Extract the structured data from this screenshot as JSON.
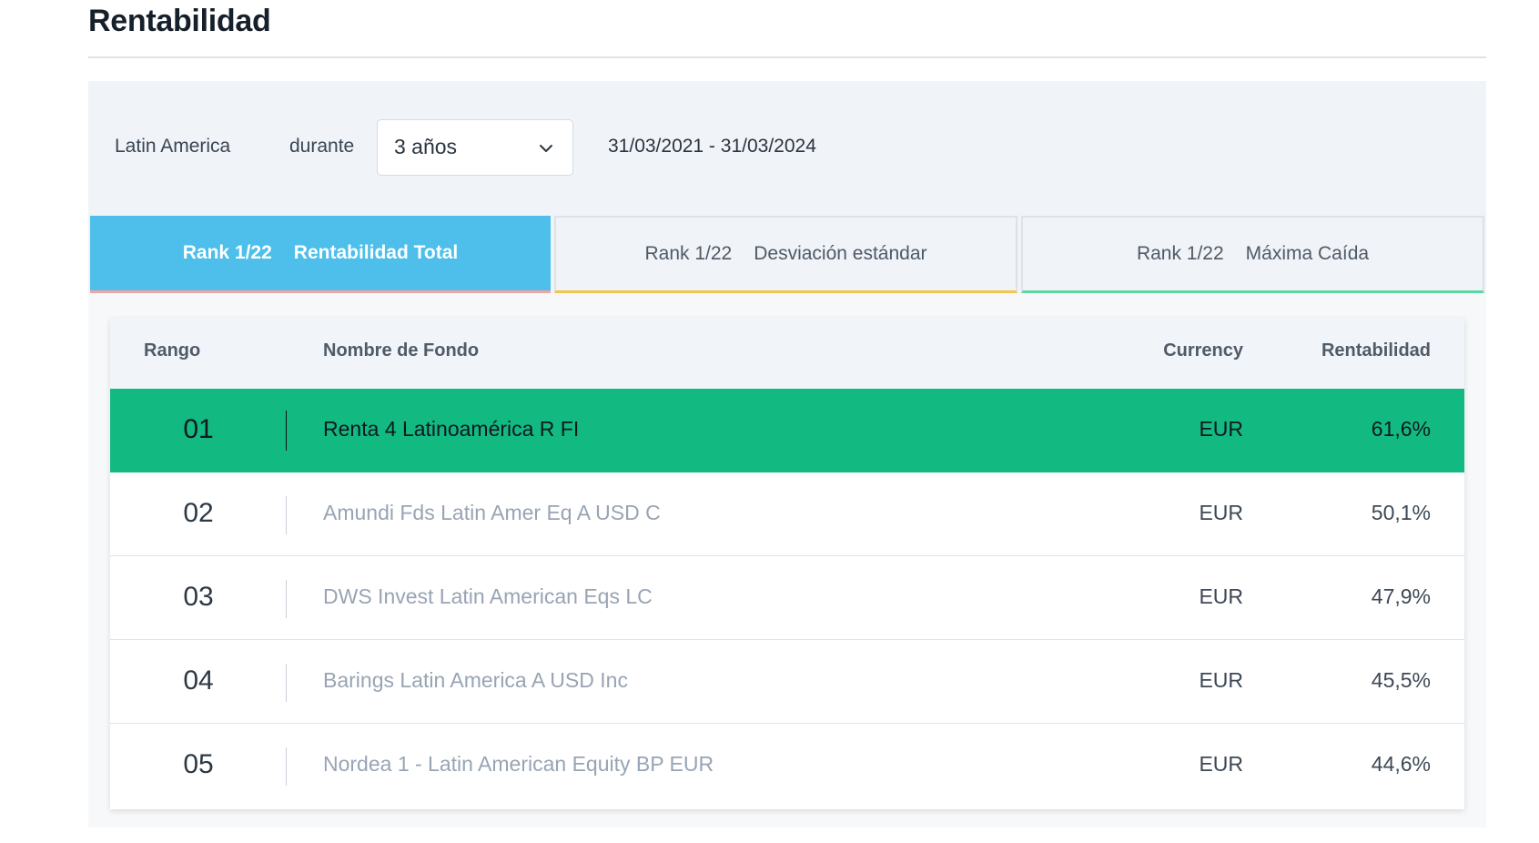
{
  "header": {
    "title": "Rentabilidad"
  },
  "filters": {
    "region": "Latin America",
    "during_label": "durante",
    "period_selected": "3 años",
    "date_range": "31/03/2021 - 31/03/2024"
  },
  "tabs": [
    {
      "rank": "Rank 1/22",
      "label": "Rentabilidad Total",
      "active": true,
      "accent_color": "#f2a3a3"
    },
    {
      "rank": "Rank 1/22",
      "label": "Desviación estándar",
      "active": false,
      "accent_color": "#f3c54d"
    },
    {
      "rank": "Rank 1/22",
      "label": "Máxima Caída",
      "active": false,
      "accent_color": "#5cd6a3"
    }
  ],
  "table": {
    "headers": {
      "rank": "Rango",
      "name": "Nombre de Fondo",
      "currency": "Currency",
      "return": "Rentabilidad"
    },
    "rows": [
      {
        "rank": "01",
        "name": "Renta 4 Latinoamérica R FI",
        "currency": "EUR",
        "return": "61,6%"
      },
      {
        "rank": "02",
        "name": "Amundi Fds Latin Amer Eq A USD C",
        "currency": "EUR",
        "return": "50,1%"
      },
      {
        "rank": "03",
        "name": "DWS Invest Latin American Eqs LC",
        "currency": "EUR",
        "return": "47,9%"
      },
      {
        "rank": "04",
        "name": "Barings Latin America A USD Inc",
        "currency": "EUR",
        "return": "45,5%"
      },
      {
        "rank": "05",
        "name": "Nordea 1 - Latin American Equity BP EUR",
        "currency": "EUR",
        "return": "44,6%"
      }
    ]
  },
  "colors": {
    "active_tab": "#4dbfea",
    "top_row": "#12b980"
  },
  "icons": {
    "select_arrow": "chevron-down-icon"
  }
}
